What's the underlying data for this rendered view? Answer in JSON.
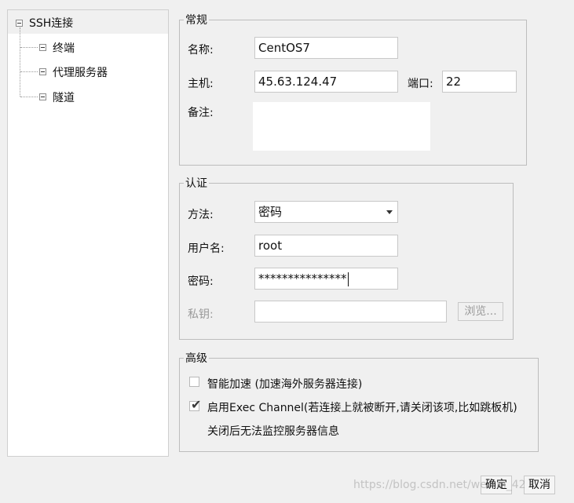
{
  "tree": {
    "root": "SSH连接",
    "children": [
      "终端",
      "代理服务器",
      "隧道"
    ]
  },
  "general": {
    "title": "常规",
    "name_label": "名称:",
    "name_value": "CentOS7",
    "host_label": "主机:",
    "host_value": "45.63.124.47",
    "port_label": "端口:",
    "port_value": "22",
    "note_label": "备注:",
    "note_value": ""
  },
  "auth": {
    "title": "认证",
    "method_label": "方法:",
    "method_value": "密码",
    "user_label": "用户名:",
    "user_value": "root",
    "password_label": "密码:",
    "password_value": "***************",
    "key_label": "私钥:",
    "key_value": "",
    "browse_label": "浏览..."
  },
  "advanced": {
    "title": "高级",
    "smart_accel_label": "智能加速 (加速海外服务器连接)",
    "smart_accel_checked": false,
    "exec_channel_label": "启用Exec Channel(若连接上就被断开,请关闭该项,比如跳板机)",
    "exec_channel_checked": true,
    "exec_channel_note": "关闭后无法监控服务器信息"
  },
  "footer": {
    "ok_label": "确定",
    "cancel_label": "取消",
    "watermark": "https://blog.csdn.net/weixin_42"
  }
}
